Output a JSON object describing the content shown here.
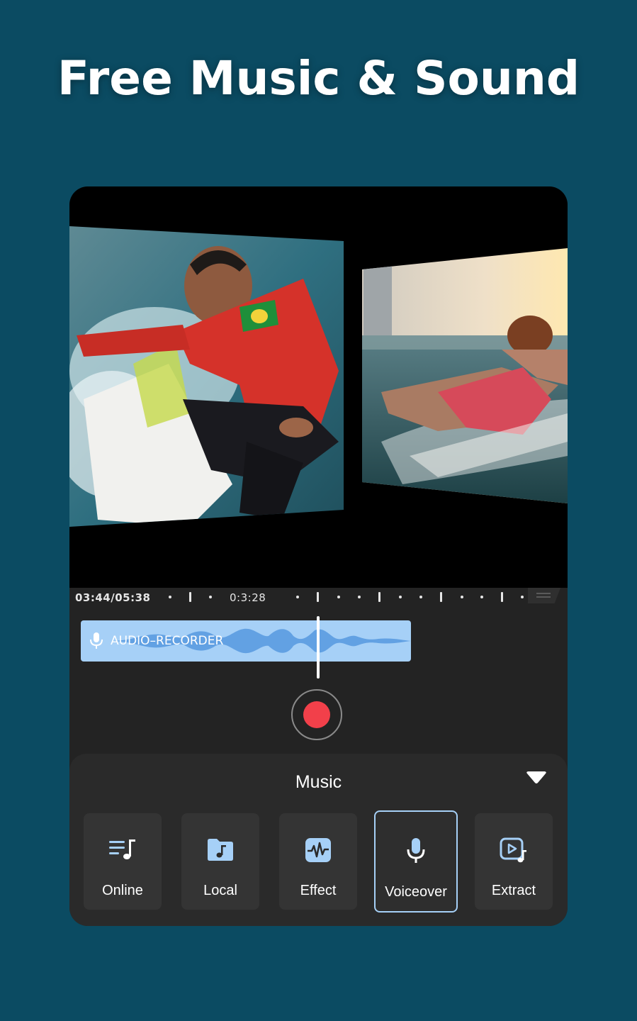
{
  "headline": "Free Music & Sound",
  "timeline": {
    "current_time": "03:44/05:38",
    "marker_time": "0:3:28"
  },
  "audio_clip": {
    "label": "AUDIO–RECORDER",
    "icon": "microphone-icon",
    "color": "#a6d0f7",
    "wave_color": "#5b9be0"
  },
  "record": {
    "color": "#f2404a"
  },
  "panel": {
    "title": "Music",
    "collapse_icon": "chevron-down-icon",
    "tools": [
      {
        "label": "Online",
        "icon": "music-list-icon"
      },
      {
        "label": "Local",
        "icon": "music-folder-icon"
      },
      {
        "label": "Effect",
        "icon": "waveform-icon"
      },
      {
        "label": "Voiceover",
        "icon": "microphone-icon",
        "selected": true
      },
      {
        "label": "Extract",
        "icon": "video-music-icon"
      }
    ]
  },
  "colors": {
    "background": "#0b4b62",
    "accent": "#a6d0f7"
  }
}
